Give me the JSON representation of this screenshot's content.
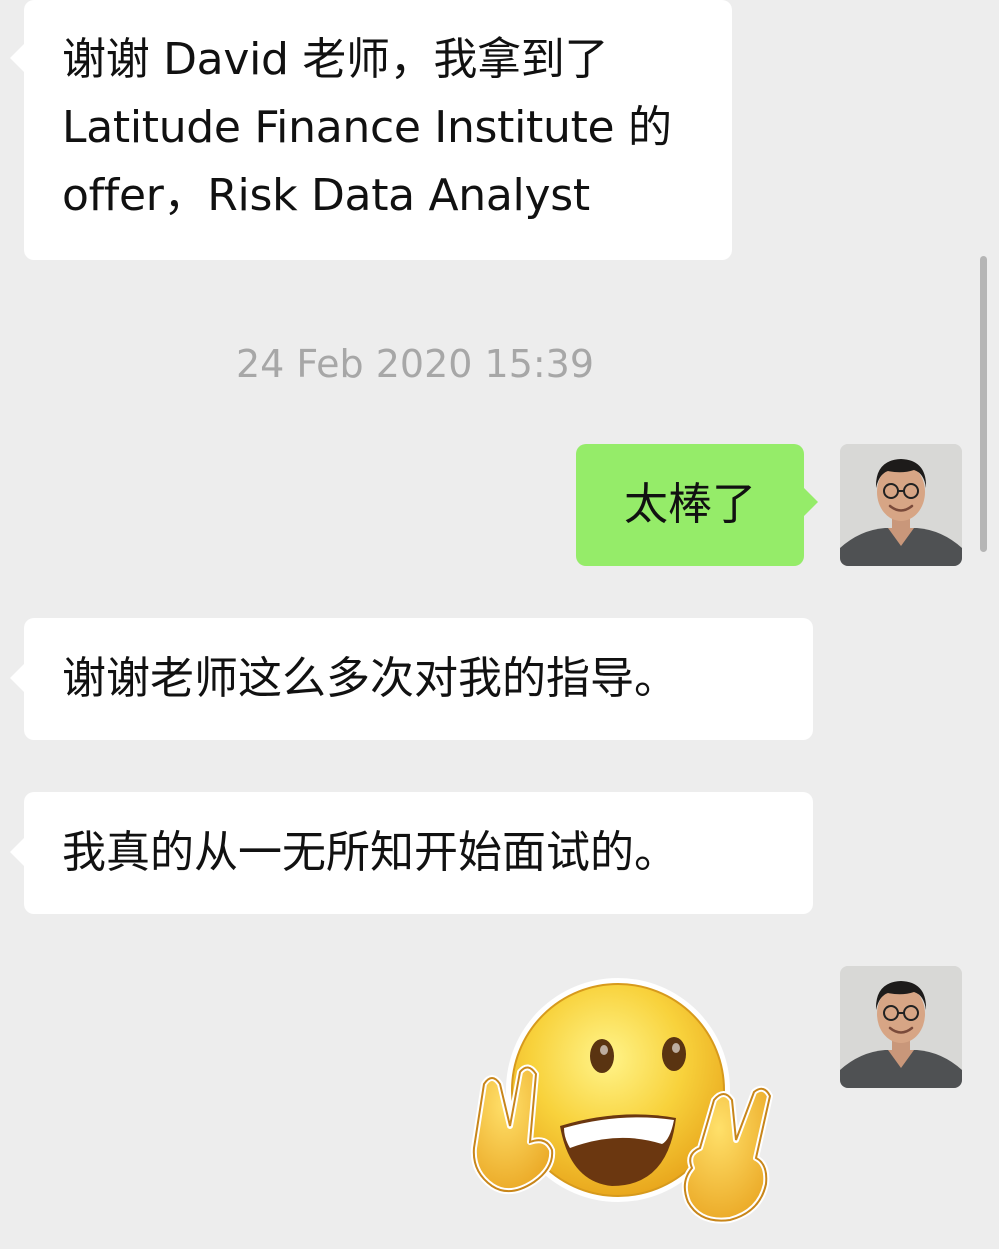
{
  "messages": [
    {
      "side": "left",
      "lines": [
        "谢谢 David 老师，我拿到了",
        "Latitude Finance Institute 的",
        "offer，Risk Data Analyst"
      ]
    },
    {
      "side": "right",
      "text": "太棒了"
    },
    {
      "side": "left",
      "text": "谢谢老师这么多次对我的指导。"
    },
    {
      "side": "left",
      "text": "我真的从一无所知开始面试的。"
    }
  ],
  "timestamp": "24 Feb 2020 15:39",
  "sticker": {
    "icon": "smiley-peace-sign-icon"
  },
  "colors": {
    "background": "#ededed",
    "incoming_bubble": "#ffffff",
    "outgoing_bubble": "#95ec69",
    "timestamp_text": "#a7a7a7"
  }
}
